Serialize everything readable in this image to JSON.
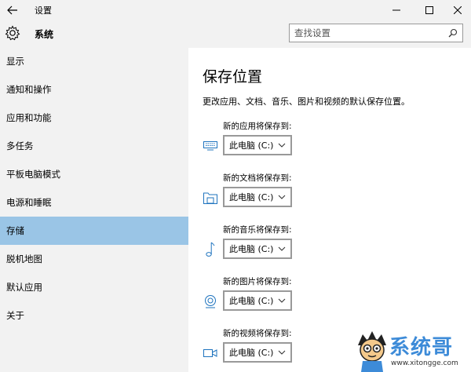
{
  "window": {
    "title": "设置"
  },
  "sidebar": {
    "header": "系统",
    "items": [
      {
        "label": "显示"
      },
      {
        "label": "通知和操作"
      },
      {
        "label": "应用和功能"
      },
      {
        "label": "多任务"
      },
      {
        "label": "平板电脑模式"
      },
      {
        "label": "电源和睡眠"
      },
      {
        "label": "存储",
        "active": true
      },
      {
        "label": "脱机地图"
      },
      {
        "label": "默认应用"
      },
      {
        "label": "关于"
      }
    ]
  },
  "search": {
    "placeholder": "查找设置"
  },
  "main": {
    "title": "保存位置",
    "description": "更改应用、文档、音乐、图片和视频的默认保存位置。",
    "locations": [
      {
        "label": "新的应用将保存到:",
        "value": "此电脑 (C:)",
        "icon": "monitor-icon"
      },
      {
        "label": "新的文档将保存到:",
        "value": "此电脑 (C:)",
        "icon": "folder-icon"
      },
      {
        "label": "新的音乐将保存到:",
        "value": "此电脑 (C:)",
        "icon": "music-note-icon"
      },
      {
        "label": "新的图片将保存到:",
        "value": "此电脑 (C:)",
        "icon": "camera-icon"
      },
      {
        "label": "新的视频将保存到:",
        "value": "此电脑 (C:)",
        "icon": "video-camera-icon"
      }
    ]
  },
  "watermark": {
    "brand": "系统哥",
    "url": "www.xitongge.com"
  },
  "colors": {
    "accent": "#1e73be",
    "active_nav": "#9ac5e6",
    "sidebar_bg": "#f2f2f2"
  }
}
